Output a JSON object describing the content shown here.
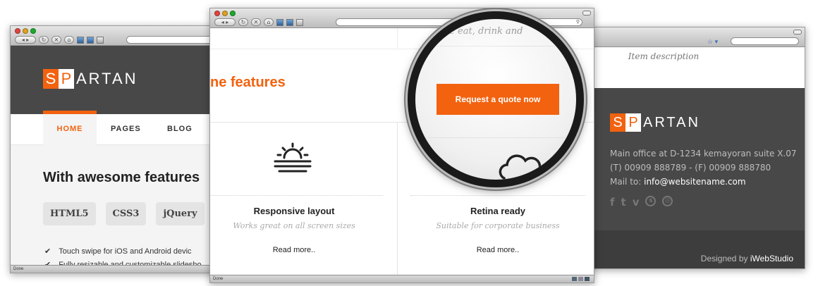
{
  "left_window": {
    "status": "Done",
    "logo": {
      "block1": "S",
      "block2": "P",
      "rest": "ARTAN"
    },
    "nav": [
      "HOME",
      "PAGES",
      "BLOG"
    ],
    "heading": "With awesome features",
    "tags": [
      "HTML5",
      "CSS3",
      "jQuery"
    ],
    "checklist": [
      "Touch swipe for iOS and Android devic",
      "Fully resizable and customizable slidesho"
    ]
  },
  "center_window": {
    "status": "Done",
    "partial_text": "re eat, drink and",
    "features_heading": "ne features",
    "cta_button": "Request a quote now",
    "columns": [
      {
        "title": "Responsive layout",
        "subtitle": "Works great on all screen sizes",
        "link": "Read more.."
      },
      {
        "title": "Retina ready",
        "subtitle": "Suitable for corporate business",
        "link": "Read more.."
      }
    ],
    "colors": {
      "accent": "#f2620f"
    }
  },
  "right_window": {
    "item_description": "Item description",
    "logo": {
      "block1": "S",
      "block2": "P",
      "rest": "ARTAN"
    },
    "address": "Main office at D-1234 kemayoran suite X.07",
    "phone": "(T) 00909 888789 - (F) 00909 888780",
    "mail_label": "Mail to:",
    "mail": "info@websitename.com",
    "social_icons": [
      "facebook-icon",
      "tumblr-icon",
      "vimeo-icon",
      "skype-icon",
      "dribbble-icon"
    ],
    "credit_prefix": "Designed by",
    "credit_name": "iWebStudio"
  }
}
